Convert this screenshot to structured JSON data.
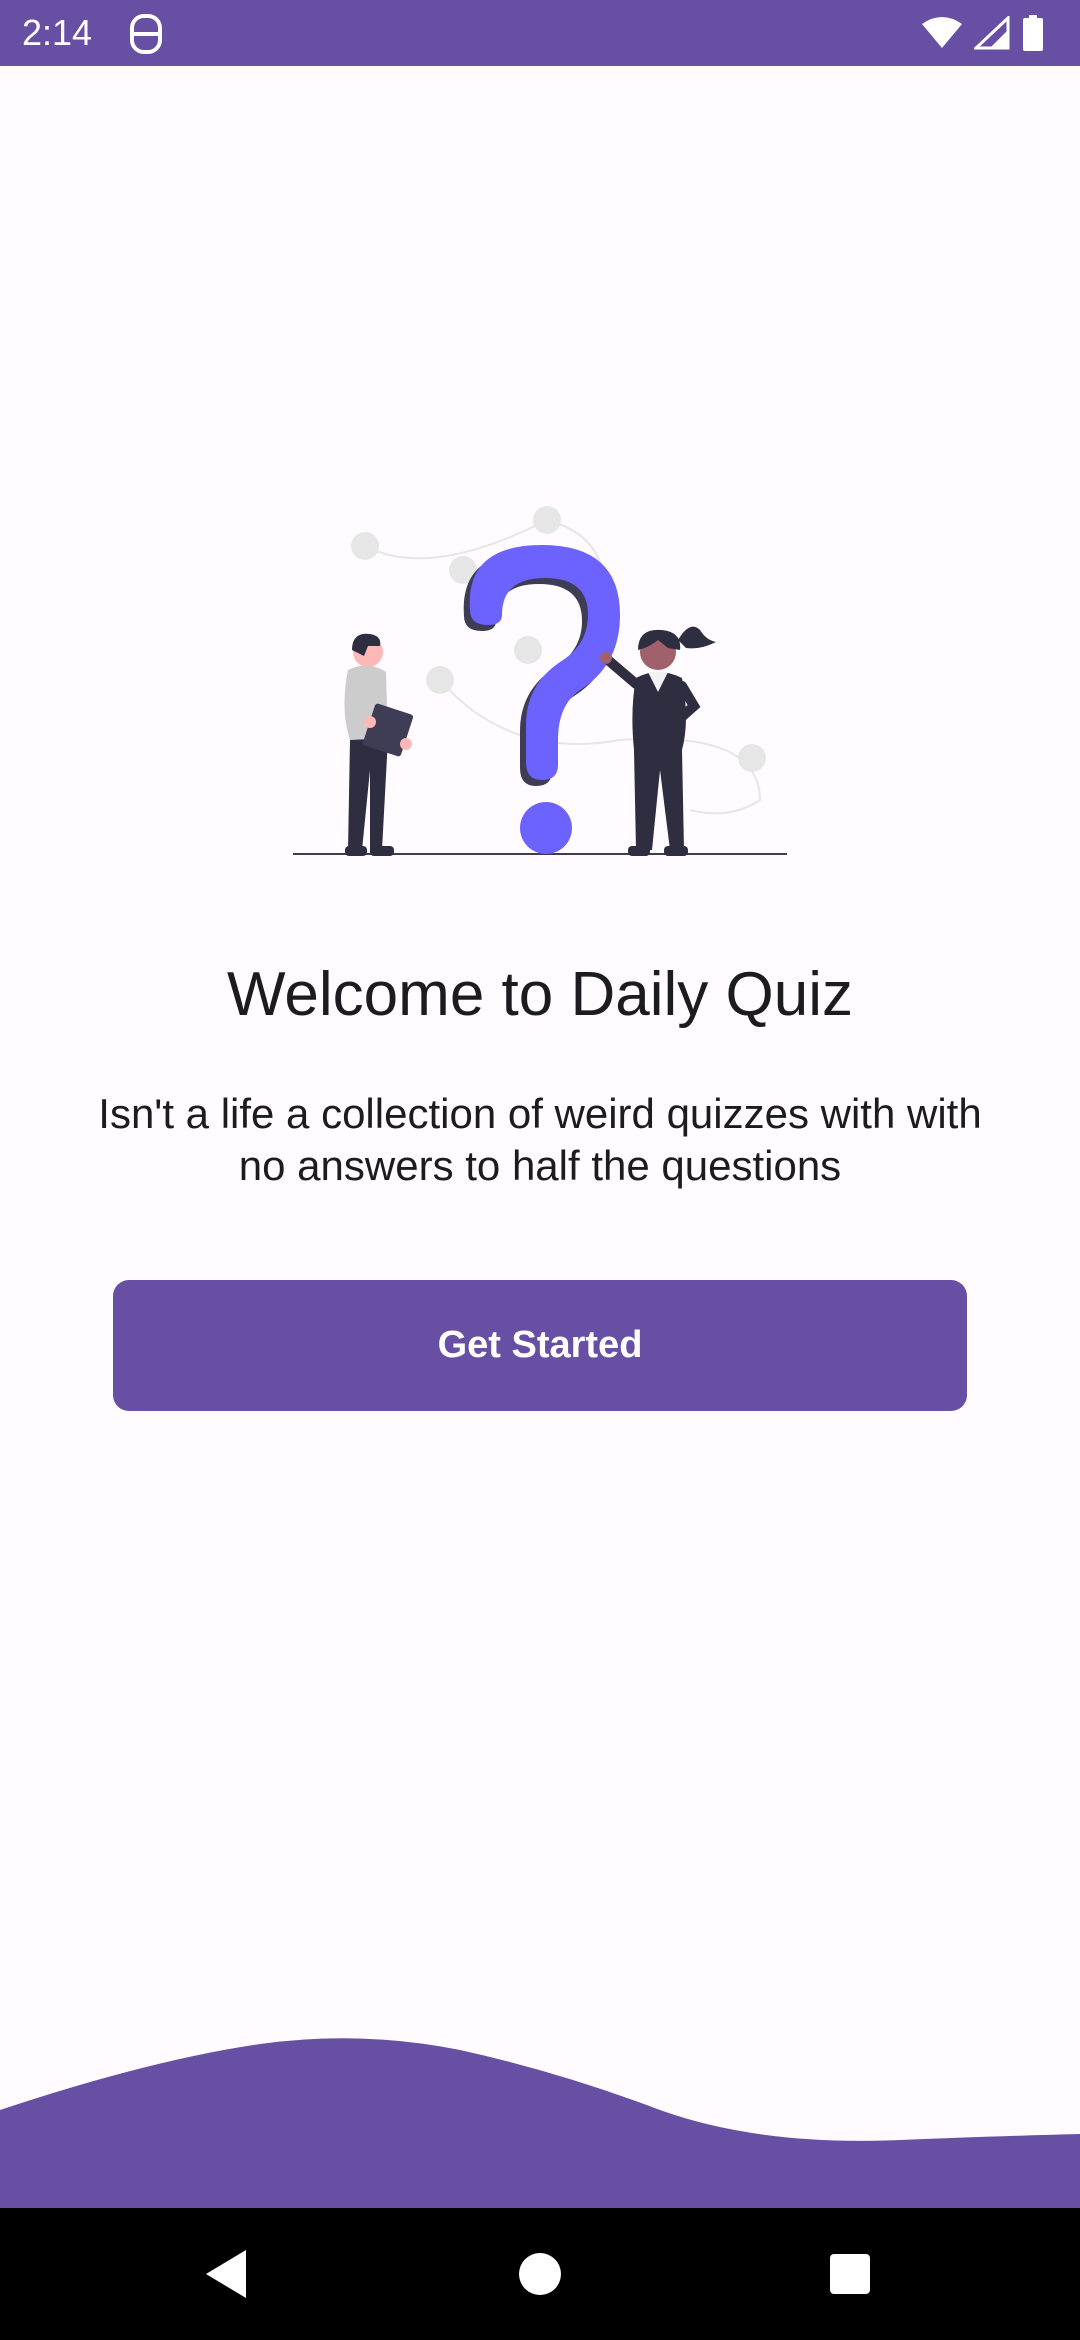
{
  "status_bar": {
    "time": "2:14",
    "icons": [
      "app-notification-icon",
      "wifi-icon",
      "signal-icon",
      "battery-icon"
    ]
  },
  "welcome": {
    "title": "Welcome to Daily Quiz",
    "subtitle": "Isn't a life a collection of weird quizzes with with no answers to half the questions",
    "button_label": "Get Started"
  },
  "navigation": {
    "buttons": [
      "back-icon",
      "home-icon",
      "recents-icon"
    ]
  },
  "colors": {
    "primary": "#6750a4",
    "background": "#fffbfe",
    "accent_illustration": "#6c63ff",
    "text": "#1c1b1f"
  }
}
